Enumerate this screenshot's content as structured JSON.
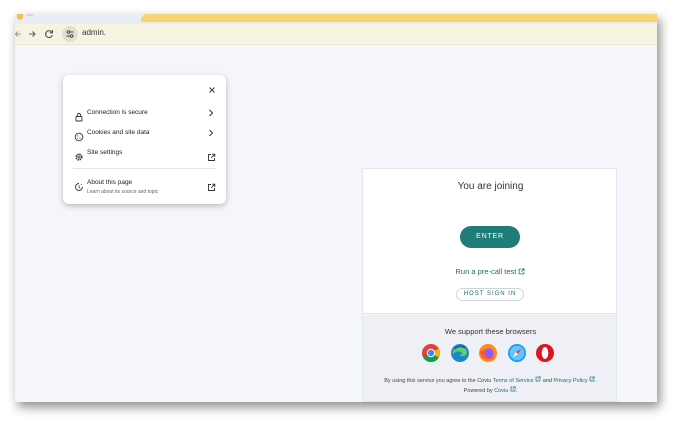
{
  "browser": {
    "url": "admin."
  },
  "site_info_popup": {
    "items": [
      {
        "label": "Connection is secure"
      },
      {
        "label": "Cookies and site data"
      },
      {
        "label": "Site settings"
      },
      {
        "label": "About this page",
        "sublabel": "Learn about its source and topic"
      }
    ]
  },
  "join": {
    "title": "You are joining",
    "enter_label": "ENTER",
    "precall_label": "Run a pre-call test",
    "host_signin_label": "HOST SIGN IN"
  },
  "browsers": {
    "title": "We support these browsers",
    "icons": [
      "chrome-icon",
      "edge-icon",
      "firefox-icon",
      "safari-icon",
      "opera-icon"
    ]
  },
  "footer": {
    "prefix": "By using this service you agree to the Coviu",
    "terms_label": "Terms of Service",
    "and": "and",
    "privacy_label": "Privacy Policy",
    "powered_by": "Powered by",
    "brand_label": "Coviu"
  },
  "colors": {
    "accent": "#1f7c78",
    "tab_yellow": "#f8d472"
  }
}
